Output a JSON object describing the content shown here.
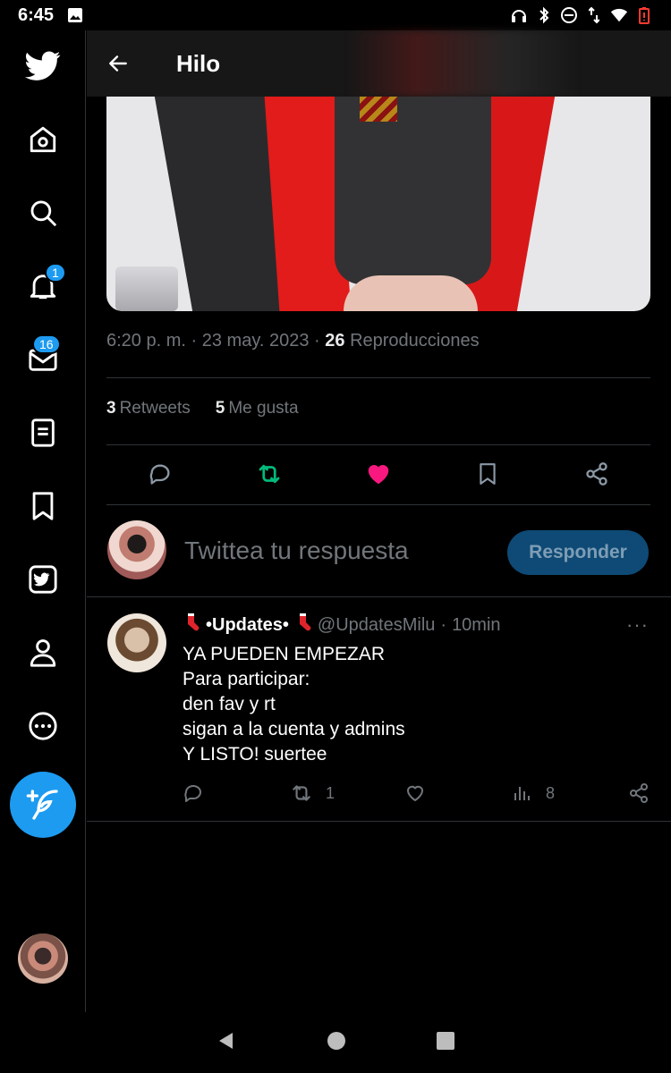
{
  "status_bar": {
    "time": "6:45"
  },
  "sidebar": {
    "notification_badge": "1",
    "messages_badge": "16"
  },
  "header": {
    "title": "Hilo"
  },
  "tweet": {
    "time": "6:20 p. m.",
    "date": "23 may. 2023",
    "separator": "·",
    "views_count": "26",
    "views_label": "Reproducciones",
    "retweets_count": "3",
    "retweets_label": "Retweets",
    "likes_count": "5",
    "likes_label": "Me gusta",
    "retweeted": true,
    "liked": true
  },
  "reply_box": {
    "placeholder": "Twittea tu respuesta",
    "button_label": "Responder"
  },
  "reply_tweet": {
    "display_name": "•Updates•",
    "handle": "@UpdatesMilu",
    "time": "10min",
    "separator": "·",
    "more": "···",
    "body": "YA PUEDEN EMPEZAR\nPara participar:\nden fav y rt\nsigan a la cuenta y admins\nY LISTO! suertee",
    "retweets": "1",
    "views": "8"
  },
  "colors": {
    "accent": "#1d9bf0",
    "retweet": "#00ba7c",
    "like": "#f91880"
  }
}
